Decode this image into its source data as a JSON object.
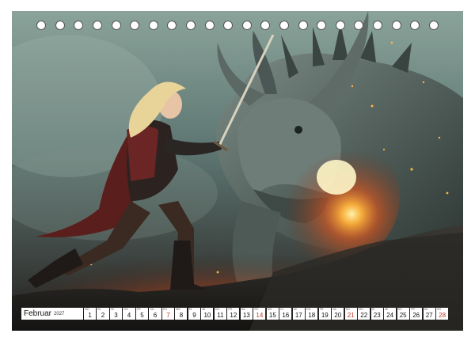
{
  "calendar": {
    "month": "Februar",
    "year": "2027",
    "days": [
      {
        "n": "1",
        "wd": "MO"
      },
      {
        "n": "2",
        "wd": "DI"
      },
      {
        "n": "3",
        "wd": "MI"
      },
      {
        "n": "4",
        "wd": "DO"
      },
      {
        "n": "5",
        "wd": "FR"
      },
      {
        "n": "6",
        "wd": "SA"
      },
      {
        "n": "7",
        "wd": "SO",
        "sunday": true
      },
      {
        "n": "8",
        "wd": "MO"
      },
      {
        "n": "9",
        "wd": "DI"
      },
      {
        "n": "10",
        "wd": "MI"
      },
      {
        "n": "11",
        "wd": "DO"
      },
      {
        "n": "12",
        "wd": "FR"
      },
      {
        "n": "13",
        "wd": "SA"
      },
      {
        "n": "14",
        "wd": "SO",
        "sunday": true
      },
      {
        "n": "15",
        "wd": "MO"
      },
      {
        "n": "16",
        "wd": "DI"
      },
      {
        "n": "17",
        "wd": "MI"
      },
      {
        "n": "18",
        "wd": "DO"
      },
      {
        "n": "19",
        "wd": "FR"
      },
      {
        "n": "20",
        "wd": "SA"
      },
      {
        "n": "21",
        "wd": "SO",
        "sunday": true
      },
      {
        "n": "22",
        "wd": "MO"
      },
      {
        "n": "23",
        "wd": "DI"
      },
      {
        "n": "24",
        "wd": "MI"
      },
      {
        "n": "25",
        "wd": "DO"
      },
      {
        "n": "26",
        "wd": "FR"
      },
      {
        "n": "27",
        "wd": "SA"
      },
      {
        "n": "28",
        "wd": "SO",
        "sunday": true
      }
    ]
  },
  "colors": {
    "sunday": "#c0392b",
    "fire": "#ff7a1a",
    "sky": "#6f8f86"
  },
  "binding": {
    "hole_count": 22
  }
}
